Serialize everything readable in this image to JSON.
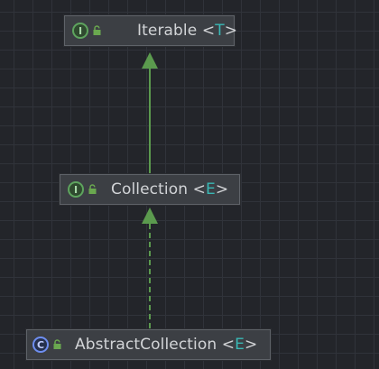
{
  "nodes": {
    "iterable": {
      "name": "Iterable",
      "type_open": "<",
      "type_param": "T",
      "type_close": ">",
      "kind": "interface",
      "kind_letter": "I",
      "visibility": "public",
      "kind_icon": "interface-icon",
      "visibility_icon": "lock-open-icon"
    },
    "collection": {
      "name": "Collection",
      "type_open": "<",
      "type_param": "E",
      "type_close": ">",
      "kind": "interface",
      "kind_letter": "I",
      "visibility": "public",
      "kind_icon": "interface-icon",
      "visibility_icon": "lock-open-icon"
    },
    "abstract_collection": {
      "name": "AbstractCollection",
      "type_open": "<",
      "type_param": "E",
      "type_close": ">",
      "kind": "class",
      "kind_letter": "C",
      "visibility": "public",
      "kind_icon": "class-icon",
      "visibility_icon": "lock-open-icon"
    }
  },
  "edges": [
    {
      "from": "collection",
      "to": "iterable",
      "relation": "extends",
      "style": "solid"
    },
    {
      "from": "abstract_collection",
      "to": "collection",
      "relation": "implements",
      "style": "dashed"
    }
  ],
  "colors": {
    "background": "#23252a",
    "grid": "#30333a",
    "node_fill": "#3c3f44",
    "node_border": "#5f6369",
    "text": "#d2d4d7",
    "type_param": "#39b8b5",
    "edge": "#5b9a4e",
    "interface_icon": "#5ea45e",
    "class_icon": "#6e8ef0",
    "lock_icon": "#6aa84f"
  }
}
